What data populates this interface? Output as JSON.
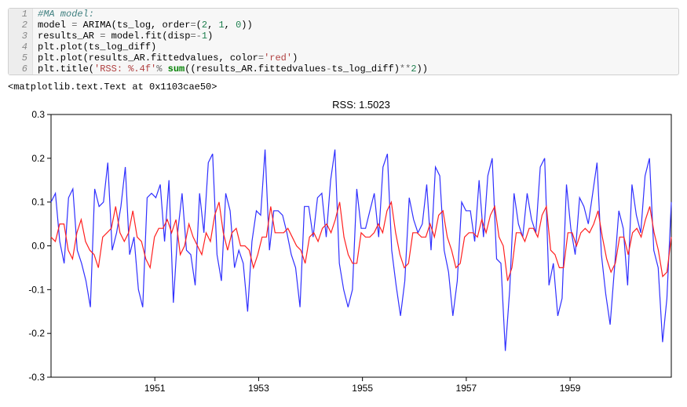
{
  "code": {
    "lines": [
      {
        "n": "1",
        "html": "<span class='c-comment'>#MA model:</span>"
      },
      {
        "n": "2",
        "html": "model <span class='c-op'>=</span> ARIMA(ts_log, order<span class='c-op'>=</span>(<span class='c-num'>2</span>, <span class='c-num'>1</span>, <span class='c-num'>0</span>))"
      },
      {
        "n": "3",
        "html": "results_AR <span class='c-op'>=</span> model.fit(disp<span class='c-op'>=-</span><span class='c-num'>1</span>)"
      },
      {
        "n": "4",
        "html": "plt.plot(ts_log_diff)"
      },
      {
        "n": "5",
        "html": "plt.plot(results_AR.fittedvalues, color<span class='c-op'>=</span><span class='c-str'>'red'</span>)"
      },
      {
        "n": "6",
        "html": "plt.title(<span class='c-str'>'RSS: %.4f'</span><span class='c-op'>%</span> <span class='c-kw'>sum</span>((results_AR.fittedvalues<span class='c-op'>-</span>ts_log_diff)<span class='c-op'>**</span><span class='c-num'>2</span>))"
      }
    ]
  },
  "output_repr": "<matplotlib.text.Text at 0x1103cae50>",
  "chart_data": {
    "type": "line",
    "title": "RSS: 1.5023",
    "xlabel": "",
    "ylabel": "",
    "ylim": [
      -0.3,
      0.3
    ],
    "xlim": [
      1949,
      1960.95
    ],
    "xticks": [
      "1951",
      "1953",
      "1955",
      "1957",
      "1959"
    ],
    "yticks": [
      "-0.3",
      "-0.2",
      "-0.1",
      "0.0",
      "0.1",
      "0.2",
      "0.3"
    ],
    "series": [
      {
        "name": "ts_log_diff",
        "color": "#3030ff",
        "y": [
          0.1,
          0.12,
          0.01,
          -0.04,
          0.11,
          0.13,
          -0.01,
          -0.04,
          -0.08,
          -0.14,
          0.13,
          0.09,
          0.1,
          0.19,
          -0.01,
          0.03,
          0.09,
          0.18,
          -0.02,
          0.02,
          -0.1,
          -0.14,
          0.11,
          0.12,
          0.11,
          0.14,
          0.01,
          0.15,
          -0.13,
          0.03,
          0.12,
          -0.01,
          -0.02,
          -0.09,
          0.12,
          0.03,
          0.19,
          0.21,
          -0.02,
          -0.08,
          0.12,
          0.08,
          -0.05,
          -0.01,
          -0.04,
          -0.15,
          0.01,
          0.08,
          0.07,
          0.22,
          -0.01,
          0.08,
          0.08,
          0.07,
          0.03,
          -0.02,
          -0.05,
          -0.14,
          0.09,
          0.09,
          0.02,
          0.11,
          0.12,
          0.02,
          0.15,
          0.22,
          -0.04,
          -0.1,
          -0.14,
          -0.1,
          0.13,
          0.04,
          0.04,
          0.08,
          0.12,
          0.02,
          0.18,
          0.21,
          -0.01,
          -0.09,
          -0.16,
          -0.08,
          0.11,
          0.06,
          0.03,
          0.05,
          0.14,
          -0.01,
          0.18,
          0.16,
          -0.01,
          -0.06,
          -0.16,
          -0.08,
          0.1,
          0.08,
          0.08,
          0.01,
          0.15,
          0.02,
          0.16,
          0.2,
          -0.03,
          -0.04,
          -0.24,
          -0.1,
          0.12,
          0.05,
          0.02,
          0.12,
          0.06,
          0.03,
          0.18,
          0.2,
          -0.09,
          -0.04,
          -0.16,
          -0.12,
          0.14,
          0.04,
          -0.02,
          0.11,
          0.09,
          0.05,
          0.12,
          0.19,
          -0.02,
          -0.11,
          -0.18,
          -0.05,
          0.08,
          0.04,
          -0.09,
          0.14,
          0.07,
          0.03,
          0.16,
          0.2,
          -0.01,
          -0.05,
          -0.22,
          -0.12,
          0.1
        ]
      },
      {
        "name": "fittedvalues",
        "color": "#ff2020",
        "y": [
          0.02,
          0.01,
          0.05,
          0.05,
          -0.01,
          -0.03,
          0.03,
          0.06,
          0.01,
          -0.01,
          -0.02,
          -0.05,
          0.02,
          0.03,
          0.04,
          0.09,
          0.03,
          0.01,
          0.03,
          0.08,
          0.02,
          0.01,
          -0.03,
          -0.05,
          0.02,
          0.04,
          0.04,
          0.06,
          0.03,
          0.06,
          -0.02,
          0.0,
          0.05,
          0.02,
          0.0,
          -0.02,
          0.03,
          0.01,
          0.07,
          0.1,
          0.03,
          -0.01,
          0.03,
          0.04,
          0.0,
          0.0,
          -0.01,
          -0.05,
          -0.02,
          0.02,
          0.02,
          0.09,
          0.03,
          0.03,
          0.03,
          0.04,
          0.02,
          0.0,
          -0.01,
          -0.04,
          0.02,
          0.03,
          0.01,
          0.04,
          0.05,
          0.03,
          0.06,
          0.1,
          0.02,
          -0.02,
          -0.04,
          -0.04,
          0.03,
          0.02,
          0.02,
          0.03,
          0.05,
          0.03,
          0.08,
          0.1,
          0.03,
          -0.02,
          -0.05,
          -0.04,
          0.03,
          0.03,
          0.02,
          0.02,
          0.05,
          0.02,
          0.07,
          0.08,
          0.02,
          -0.01,
          -0.05,
          -0.04,
          0.02,
          0.03,
          0.03,
          0.02,
          0.06,
          0.03,
          0.07,
          0.09,
          0.02,
          0.0,
          -0.08,
          -0.05,
          0.03,
          0.03,
          0.01,
          0.04,
          0.04,
          0.02,
          0.07,
          0.09,
          -0.01,
          -0.02,
          -0.05,
          -0.05,
          0.03,
          0.03,
          0.0,
          0.03,
          0.04,
          0.03,
          0.05,
          0.08,
          0.02,
          -0.03,
          -0.06,
          -0.04,
          0.02,
          0.02,
          -0.02,
          0.03,
          0.04,
          0.02,
          0.06,
          0.09,
          0.03,
          -0.01,
          -0.07,
          -0.06,
          0.02
        ]
      }
    ]
  }
}
